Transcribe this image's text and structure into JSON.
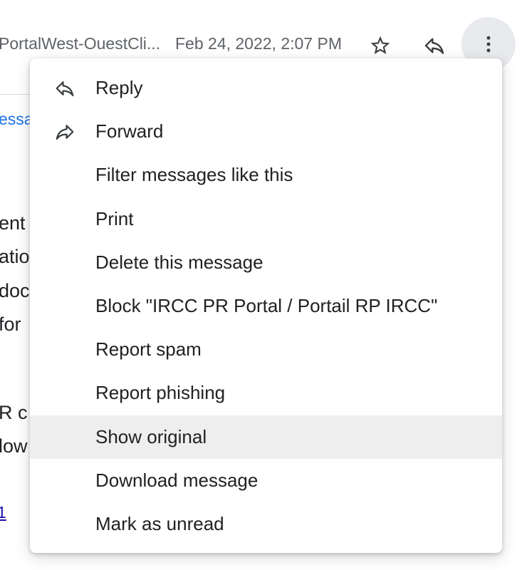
{
  "header": {
    "sender": "PortalWest-OuestCli...",
    "date": "Feb 24, 2022, 2:07 PM",
    "star_icon": "star-outline-icon",
    "reply_icon": "reply-icon",
    "more_icon": "more-vert-icon"
  },
  "background": {
    "link_fragment": "essa",
    "lines": [
      "ent r",
      "atio",
      "doc",
      " for",
      "R  c",
      "low"
    ],
    "link_fragment_2": "1"
  },
  "menu": {
    "items": [
      {
        "label": "Reply",
        "icon": "reply-icon"
      },
      {
        "label": "Forward",
        "icon": "forward-icon"
      },
      {
        "label": "Filter messages like this",
        "icon": ""
      },
      {
        "label": "Print",
        "icon": ""
      },
      {
        "label": "Delete this message",
        "icon": ""
      },
      {
        "label": "Block \"IRCC PR Portal / Portail RP IRCC\"",
        "icon": ""
      },
      {
        "label": "Report spam",
        "icon": ""
      },
      {
        "label": "Report phishing",
        "icon": ""
      },
      {
        "label": "Show original",
        "icon": "",
        "highlighted": true
      },
      {
        "label": "Download message",
        "icon": ""
      },
      {
        "label": "Mark as unread",
        "icon": ""
      }
    ]
  },
  "colors": {
    "highlight": "#eeeeee",
    "text": "#202124",
    "secondary_text": "#5f6368",
    "link": "#1a73e8"
  }
}
